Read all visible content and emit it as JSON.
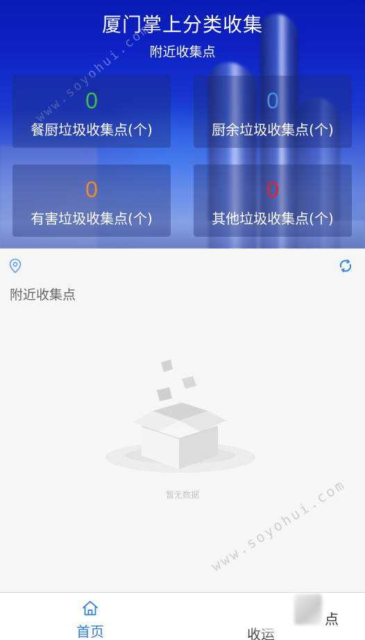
{
  "header": {
    "title": "厦门掌上分类收集",
    "subtitle": "附近收集点"
  },
  "stats": [
    {
      "value": "0",
      "label": "餐厨垃圾收集点(个)",
      "color": "#3fc23a"
    },
    {
      "value": "0",
      "label": "厨余垃圾收集点(个)",
      "color": "#4a8fe0"
    },
    {
      "value": "0",
      "label": "有害垃圾收集点(个)",
      "color": "#f08a24"
    },
    {
      "value": "0",
      "label": "其他垃圾收集点(个)",
      "color": "#e2222e"
    }
  ],
  "main": {
    "section_title": "附近收集点",
    "empty_text": "暂无数据",
    "icons": [
      "location-pin-icon",
      "refresh-icon"
    ]
  },
  "watermark": "www.soyohui.com",
  "tabbar": {
    "tabs": [
      {
        "label": "首页",
        "icon": "home-icon",
        "active": true
      },
      {
        "label": "收运",
        "label_suffix": "点",
        "icon": "",
        "active": false
      }
    ],
    "active_color": "#2f7fd7"
  }
}
